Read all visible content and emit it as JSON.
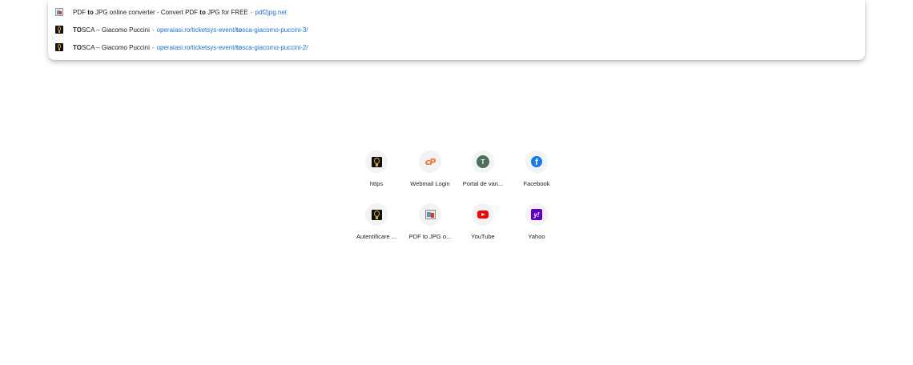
{
  "dropdown": {
    "suggestions": [
      {
        "icon": "pdf2jpg-favicon",
        "title_parts": [
          "PDF ",
          "to",
          " JPG online converter - Convert PDF ",
          "to",
          " JPG for FREE"
        ],
        "separator": "-",
        "url_parts": [
          "pdf2jpg.net"
        ]
      },
      {
        "icon": "operaiasi-favicon",
        "title_parts": [
          "TO",
          "SCA – Giacomo Puccini"
        ],
        "separator": "-",
        "url_parts": [
          "operaiasi.ro/ticketsys-event/",
          "to",
          "sca-giacomo-puccini-3/"
        ]
      },
      {
        "icon": "operaiasi-favicon",
        "title_parts": [
          "TO",
          "SCA – Giacomo Puccini"
        ],
        "separator": "-",
        "url_parts": [
          "operaiasi.ro/ticketsys-event/",
          "to",
          "sca-giacomo-puccini-2/"
        ]
      }
    ]
  },
  "shortcuts": [
    {
      "label": "https",
      "icon": "operaiasi-icon"
    },
    {
      "label": "Webmail Login",
      "icon": "cpanel-icon"
    },
    {
      "label": "Portal de van...",
      "icon": "letter-t-icon",
      "icon_letter": "T"
    },
    {
      "label": "Facebook",
      "icon": "facebook-icon",
      "icon_letter": "f"
    },
    {
      "label": "Autentificare ...",
      "icon": "operaiasi-icon"
    },
    {
      "label": "PDF to JPG o...",
      "icon": "pdf2jpg-icon"
    },
    {
      "label": "YouTube",
      "icon": "youtube-icon"
    },
    {
      "label": "Yahoo",
      "icon": "yahoo-icon",
      "icon_letter": "y!"
    }
  ],
  "colors": {
    "url_link": "#1a73e8",
    "text": "#202124",
    "tile_bg": "#f1f3f4",
    "facebook": "#1877f2",
    "youtube": "#ff0000",
    "yahoo": "#6001d2",
    "cpanel": "#ff6c2c"
  }
}
